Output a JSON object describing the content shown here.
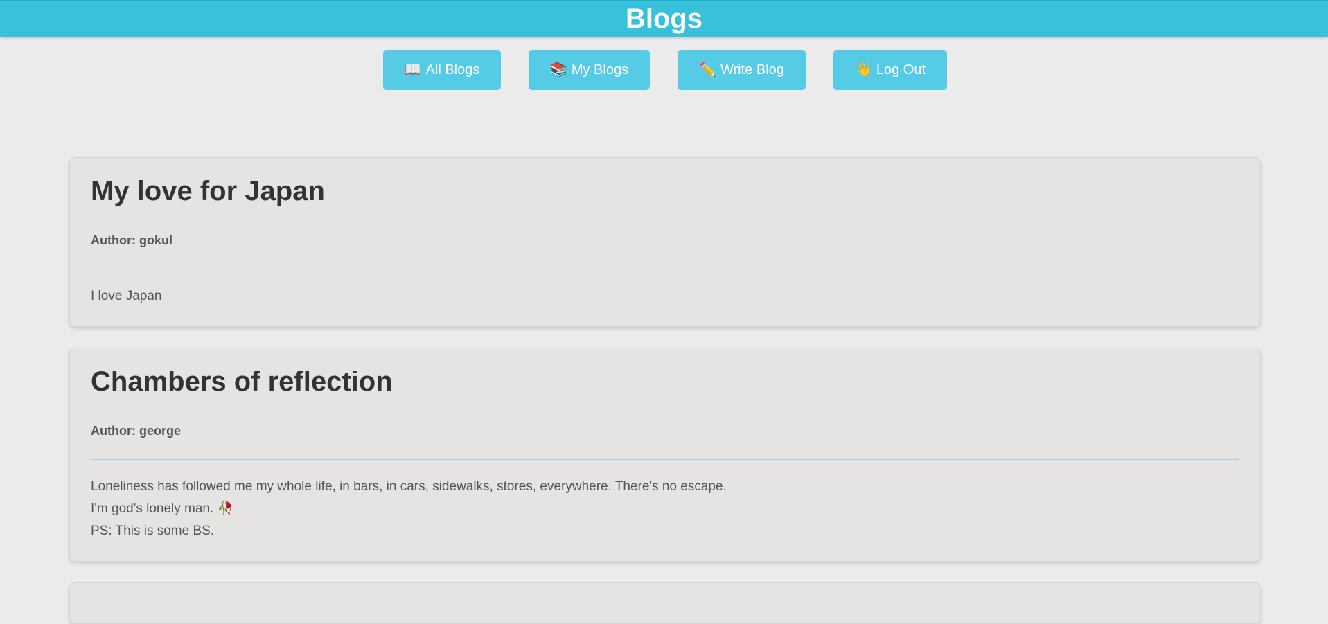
{
  "header": {
    "title": "Blogs"
  },
  "nav": {
    "all_blogs": {
      "icon": "📖",
      "label": "All Blogs"
    },
    "my_blogs": {
      "icon": "📚",
      "label": "My Blogs"
    },
    "write_blog": {
      "icon": "✏️",
      "label": "Write Blog"
    },
    "log_out": {
      "icon": "👋",
      "label": "Log Out"
    }
  },
  "posts": [
    {
      "title": "My love for Japan",
      "author": "Author: gokul",
      "body": [
        "I love Japan"
      ]
    },
    {
      "title": "Chambers of reflection",
      "author": "Author: george",
      "body": [
        "Loneliness has followed me my whole life, in bars, in cars, sidewalks, stores, everywhere. There's no escape.",
        "I'm god's lonely man. 🥀",
        "PS: This is some BS."
      ]
    }
  ],
  "colors": {
    "accent": "#38c1db",
    "button": "#55cbe6",
    "page_bg": "#ebebeb",
    "card_bg": "#e6e4e2"
  }
}
